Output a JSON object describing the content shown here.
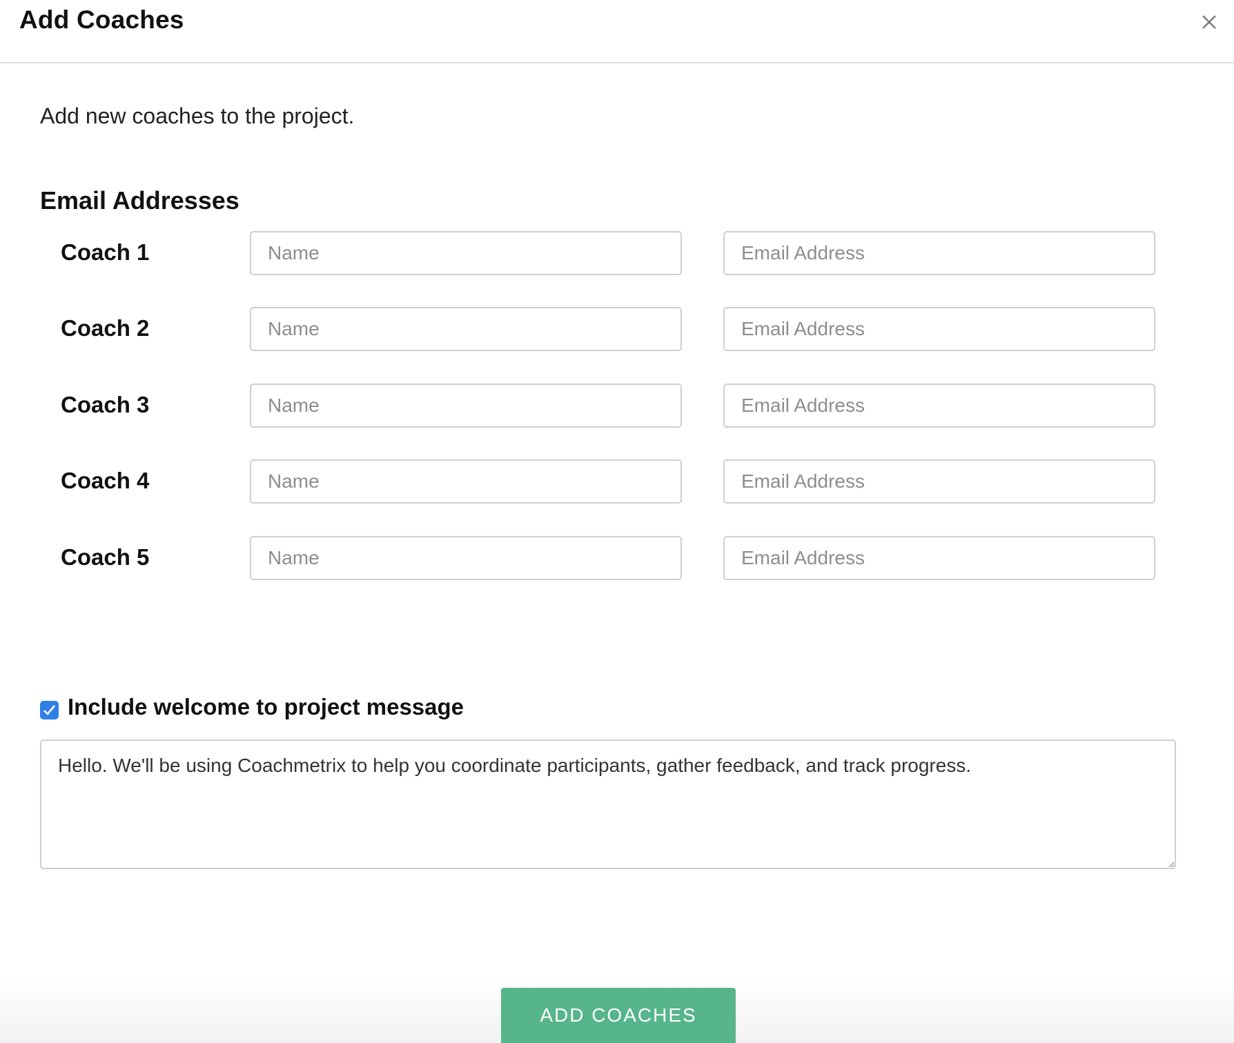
{
  "modal": {
    "title": "Add Coaches",
    "close_icon": "close-icon",
    "intro": "Add new coaches to the project.",
    "section_heading": "Email Addresses"
  },
  "coaches": [
    {
      "label": "Coach 1",
      "name_placeholder": "Name",
      "email_placeholder": "Email Address"
    },
    {
      "label": "Coach 2",
      "name_placeholder": "Name",
      "email_placeholder": "Email Address"
    },
    {
      "label": "Coach 3",
      "name_placeholder": "Name",
      "email_placeholder": "Email Address"
    },
    {
      "label": "Coach 4",
      "name_placeholder": "Name",
      "email_placeholder": "Email Address"
    },
    {
      "label": "Coach 5",
      "name_placeholder": "Name",
      "email_placeholder": "Email Address"
    }
  ],
  "welcome": {
    "checkbox_checked": true,
    "checkbox_label": "Include welcome to project message",
    "message": "Hello. We'll be using Coachmetrix to help you coordinate participants, gather feedback, and track progress."
  },
  "footer": {
    "submit_label": "ADD COACHES"
  },
  "colors": {
    "accent_button": "#56b58a",
    "checkbox": "#2f7fe6"
  }
}
